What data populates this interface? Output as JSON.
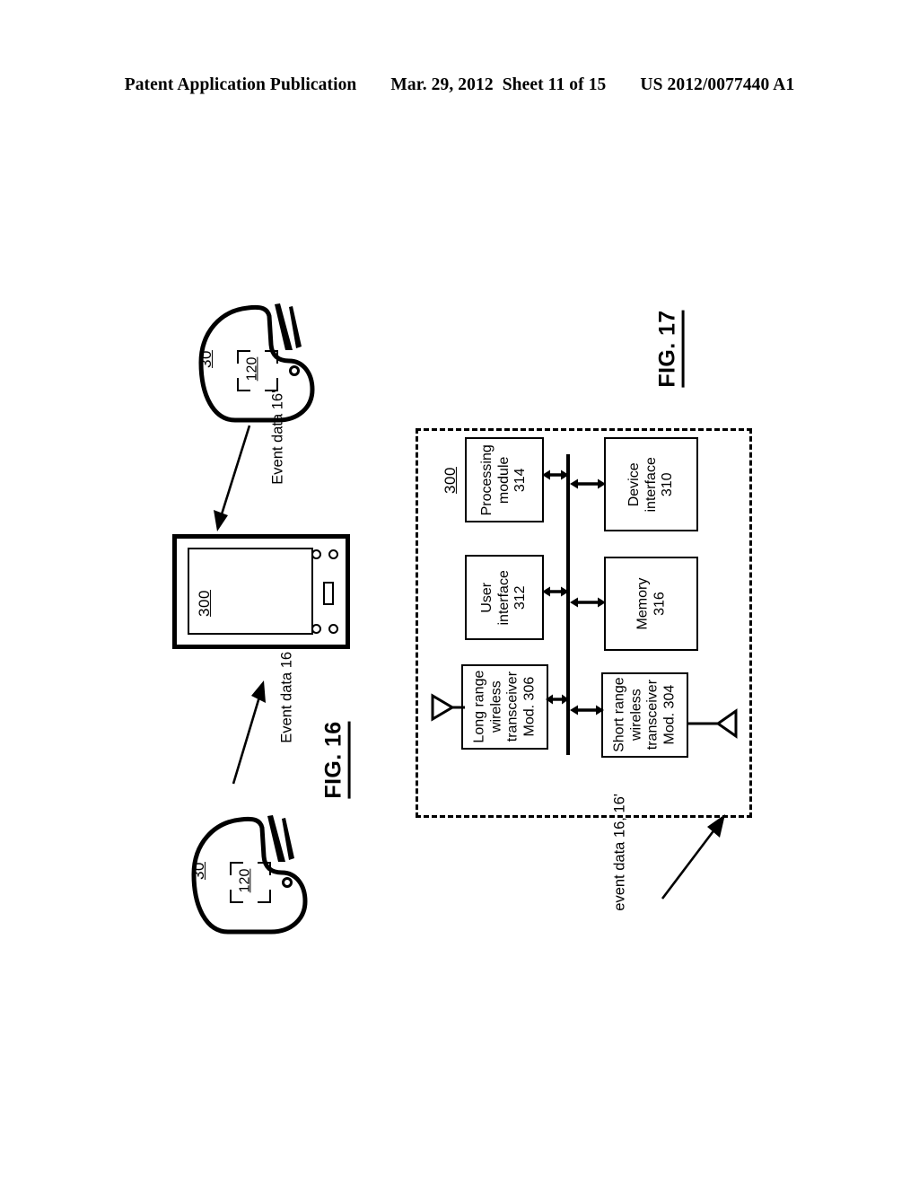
{
  "header": {
    "publication": "Patent Application Publication",
    "date": "Mar. 29, 2012",
    "sheet": "Sheet 11 of 15",
    "pub_number": "US 2012/0077440 A1"
  },
  "fig16": {
    "caption": "FIG. 16",
    "shoe_top": {
      "ref": "30",
      "sensor_ref": "120"
    },
    "shoe_bottom": {
      "ref": "30",
      "sensor_ref": "120"
    },
    "handheld": {
      "ref": "300"
    },
    "flow_down": "Event data\n16'",
    "flow_up": "Event data\n16"
  },
  "fig17": {
    "caption": "FIG. 17",
    "device_ref": "300",
    "blocks": [
      {
        "name": "processing-module",
        "label": "Processing\nmodule\n314"
      },
      {
        "name": "device-interface",
        "label": "Device\ninterface\n310"
      },
      {
        "name": "user-interface",
        "label": "User\ninterface\n312"
      },
      {
        "name": "memory",
        "label": "Memory\n316"
      },
      {
        "name": "long-range-transceiver",
        "label": "Long range\nwireless\ntransceiver\nMod. 306"
      },
      {
        "name": "short-range-transceiver",
        "label": "Short range\nwireless\ntransceiver\nMod. 304"
      }
    ],
    "event_data_label": "event data\n16, 16'"
  },
  "colors": {
    "ink": "#000000",
    "paper": "#ffffff"
  }
}
